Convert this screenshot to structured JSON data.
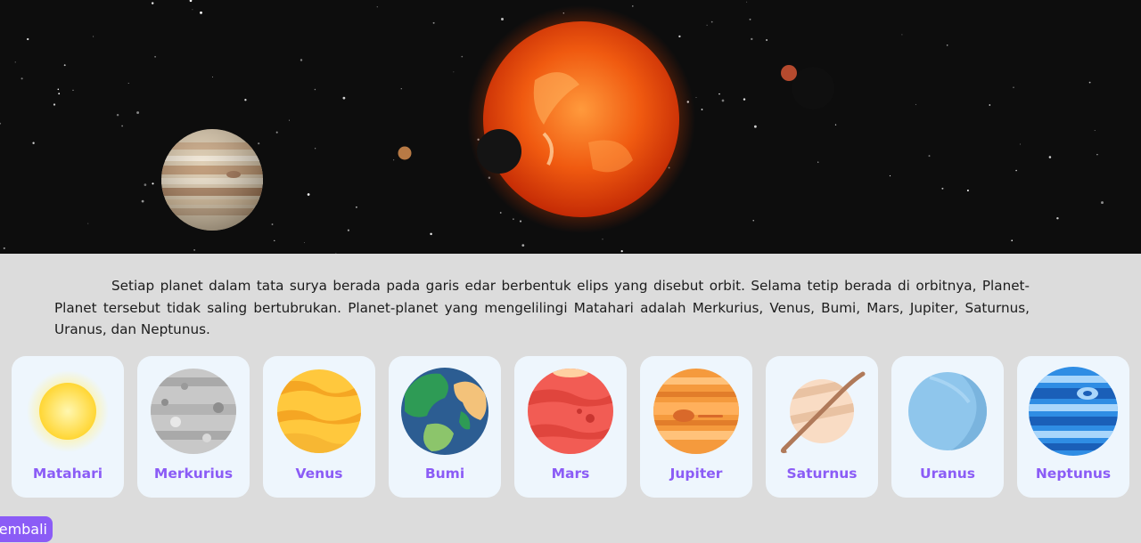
{
  "hero": {
    "image": "solar-system-banner"
  },
  "description": "Setiap planet dalam tata surya berada pada garis edar berbentuk elips yang disebut orbit. Selama tetip berada di orbitnya, Planet-Planet tersebut tidak saling bertubrukan. Planet-planet yang mengelilingi Matahari adalah Merkurius, Venus, Bumi, Mars, Jupiter, Saturnus, Uranus, dan Neptunus.",
  "planets": [
    {
      "label": "Matahari",
      "icon": "sun-icon"
    },
    {
      "label": "Merkurius",
      "icon": "mercury-icon"
    },
    {
      "label": "Venus",
      "icon": "venus-icon"
    },
    {
      "label": "Bumi",
      "icon": "earth-icon"
    },
    {
      "label": "Mars",
      "icon": "mars-icon"
    },
    {
      "label": "Jupiter",
      "icon": "jupiter-icon"
    },
    {
      "label": "Saturnus",
      "icon": "saturn-icon"
    },
    {
      "label": "Uranus",
      "icon": "uranus-icon"
    },
    {
      "label": "Neptunus",
      "icon": "neptune-icon"
    }
  ],
  "back_button": {
    "label": "embali"
  },
  "colors": {
    "accent": "#8b5cf6",
    "card_bg": "#eef6fd",
    "page_bg": "#dcdcdc"
  }
}
